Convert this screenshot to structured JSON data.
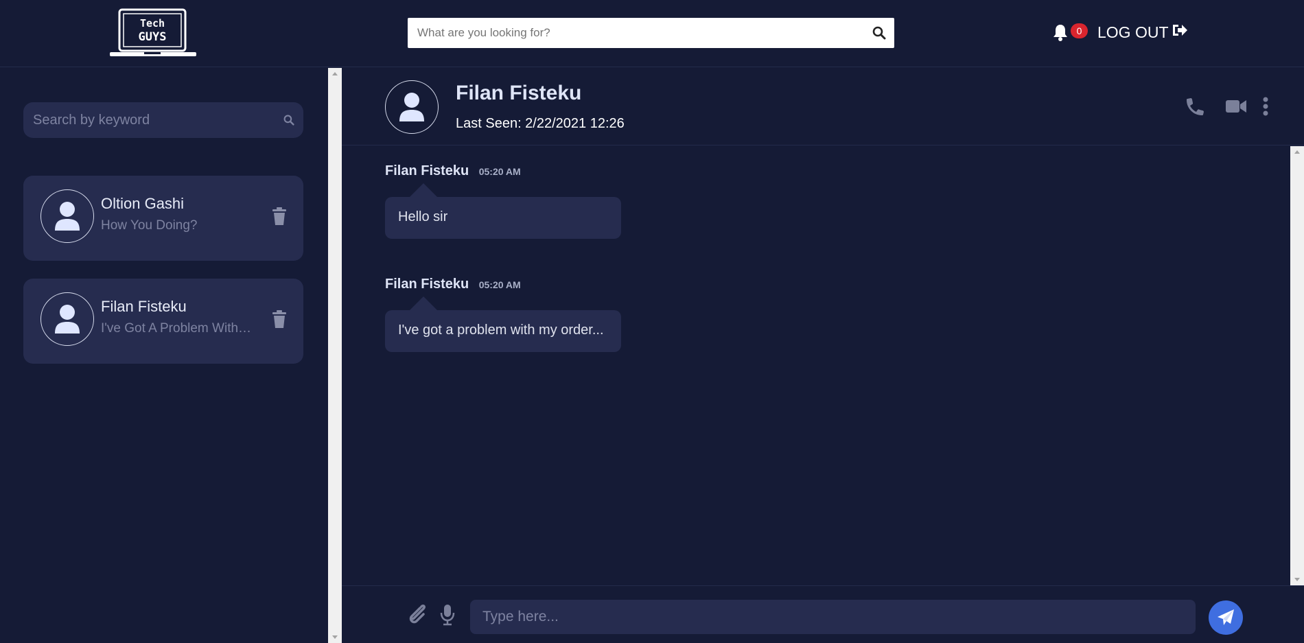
{
  "header": {
    "logo_line1": "Tech",
    "logo_line2": "GUYS",
    "search_placeholder": "What are you looking for?",
    "notification_count": "0",
    "logout_label": "LOG OUT"
  },
  "sidebar": {
    "search_placeholder": "Search by keyword",
    "contacts": [
      {
        "name": "Oltion Gashi",
        "preview": "How You Doing?"
      },
      {
        "name": "Filan Fisteku",
        "preview": "I've Got A Problem With My Order..."
      }
    ]
  },
  "chat": {
    "name": "Filan Fisteku",
    "last_seen": "Last Seen: 2/22/2021 12:26",
    "messages": [
      {
        "sender": "Filan Fisteku",
        "time": "05:20 AM",
        "text": "Hello sir"
      },
      {
        "sender": "Filan Fisteku",
        "time": "05:20 AM",
        "text": "I've got a problem with my order..."
      }
    ]
  },
  "composer": {
    "placeholder": "Type here..."
  },
  "colors": {
    "background": "#151b36",
    "panel": "#262c4f",
    "accent": "#3f6ee0",
    "badge": "#d9252e"
  },
  "icons": [
    "laptop-logo",
    "search-icon",
    "bell-icon",
    "sign-out-icon",
    "user-icon",
    "trash-icon",
    "phone-icon",
    "video-icon",
    "more-vertical-icon",
    "paperclip-icon",
    "microphone-icon",
    "send-icon"
  ]
}
